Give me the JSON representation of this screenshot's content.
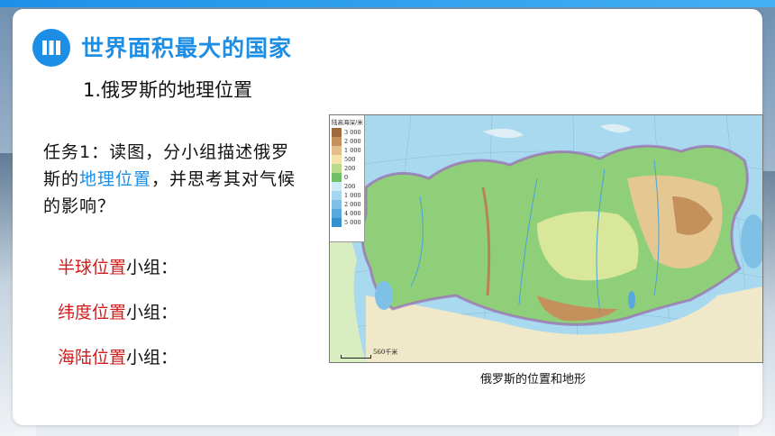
{
  "header": {
    "icon": "book-icon",
    "title": "世界面积最大的国家",
    "accent_color": "#1c8ee6"
  },
  "section": {
    "subtitle": "1.俄罗斯的地理位置"
  },
  "task": {
    "part1": "任务1：读图，分小组描述俄罗斯的",
    "highlight": "地理位置",
    "part2": "，并思考其对气候的影响？"
  },
  "groups": [
    {
      "highlight": "半球位置",
      "rest": "小组："
    },
    {
      "highlight": "纬度位置",
      "rest": "小组："
    },
    {
      "highlight": "海陆位置",
      "rest": "小组："
    }
  ],
  "map": {
    "legend_title": "陆高海深/米",
    "legend": [
      {
        "label": "3 000",
        "color": "#9c6a3c"
      },
      {
        "label": "2 000",
        "color": "#c4905c"
      },
      {
        "label": "1 000",
        "color": "#e3c08a"
      },
      {
        "label": "500",
        "color": "#f2e3a6"
      },
      {
        "label": "200",
        "color": "#b9d98b"
      },
      {
        "label": "0",
        "color": "#6fbf6a"
      },
      {
        "label": "200",
        "color": "#cfeaf6"
      },
      {
        "label": "1 000",
        "color": "#a6d6ee"
      },
      {
        "label": "2 000",
        "color": "#7fc1e6"
      },
      {
        "label": "4 000",
        "color": "#56a9dc"
      },
      {
        "label": "5 000",
        "color": "#3391cf"
      }
    ],
    "scale_label": "560千米",
    "caption": "俄罗斯的位置和地形"
  }
}
